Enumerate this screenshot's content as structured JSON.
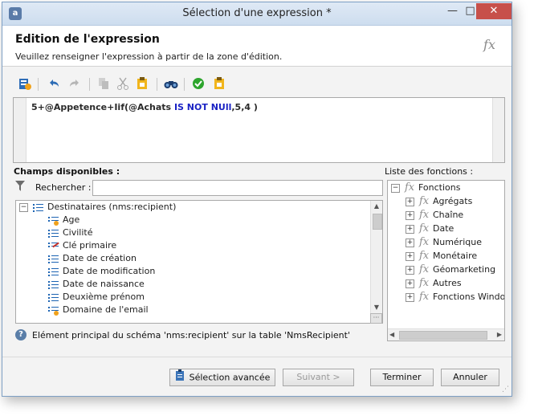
{
  "window": {
    "title": "Sélection d'une expression *",
    "min": "—",
    "max": "□",
    "close": "✕"
  },
  "header": {
    "title": "Edition de l'expression",
    "subtitle": "Veuillez renseigner l'expression à partir de la zone d'édition.",
    "fx": "fx"
  },
  "editor": {
    "parts": [
      "5+@Appetence+Iif(@Achats ",
      "IS NOT NUll",
      ",5,4 )"
    ]
  },
  "fields": {
    "label": "Champs disponibles :",
    "search_label": "Rechercher :",
    "search_value": "",
    "root": "Destinataires (nms:recipient)",
    "items": [
      "Age",
      "Civilité",
      "Clé primaire",
      "Date de création",
      "Date de modification",
      "Date de naissance",
      "Deuxième prénom",
      "Domaine de l'email"
    ]
  },
  "functions": {
    "label": "Liste des fonctions :",
    "root": "Fonctions",
    "items": [
      "Agrégats",
      "Chaîne",
      "Date",
      "Numérique",
      "Monétaire",
      "Géomarketing",
      "Autres",
      "Fonctions Windo"
    ]
  },
  "info": {
    "text": "Elément principal du schéma 'nms:recipient' sur la table 'NmsRecipient'"
  },
  "buttons": {
    "advanced": "Sélection avancée",
    "next": "Suivant >",
    "finish": "Terminer",
    "cancel": "Annuler"
  },
  "colors": {
    "keyword": "#1a22c4",
    "accent": "#1d64b3",
    "close": "#c7504a",
    "check": "#2da52d"
  }
}
